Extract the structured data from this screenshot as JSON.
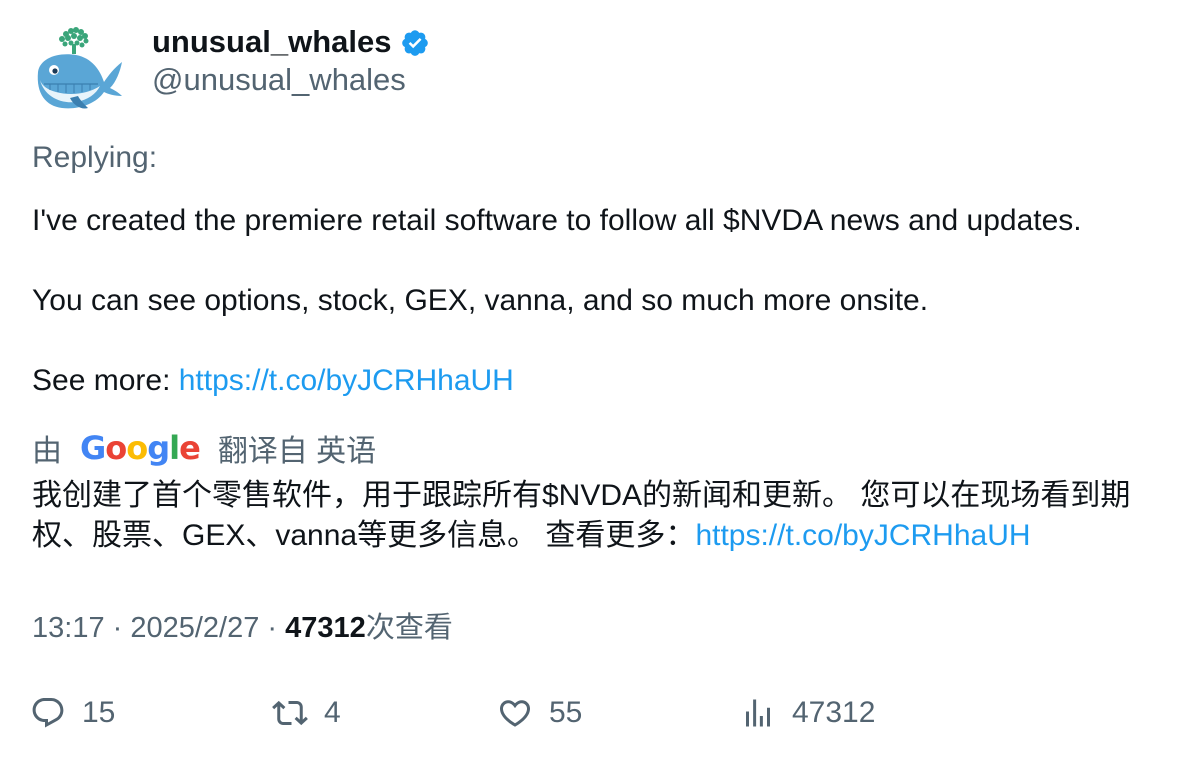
{
  "author": {
    "display_name": "unusual_whales",
    "handle": "@unusual_whales",
    "verified": true,
    "avatar_icon": "whale-logo-icon",
    "verified_icon": "verified-badge-icon"
  },
  "tweet": {
    "replying_label": "Replying:",
    "line1": "I've created the premiere retail software to follow all $NVDA news and updates.",
    "line2": "You can see options, stock, GEX, vanna, and so much more onsite.",
    "line3_prefix": "See more: ",
    "link": "https://t.co/byJCRHhaUH"
  },
  "translation": {
    "by_label": "由",
    "google_letters": [
      "G",
      "o",
      "o",
      "g",
      "l",
      "e"
    ],
    "google_colors": [
      "#4285F4",
      "#EA4335",
      "#FBBC05",
      "#4285F4",
      "#34A853",
      "#EA4335"
    ],
    "from_label": "翻译自 英语",
    "text": "我创建了首个零售软件，用于跟踪所有$NVDA的新闻和更新。 您可以在现场看到期权、股票、GEX、vanna等更多信息。 查看更多：",
    "link": "https://t.co/byJCRHhaUH"
  },
  "meta": {
    "time": "13:17",
    "date": "2025/2/27",
    "sep": " · ",
    "views": "47312",
    "views_label": "次查看"
  },
  "actions": {
    "replies": "15",
    "reposts": "4",
    "likes": "55",
    "views": "47312"
  },
  "colors": {
    "link": "#1d9bf0",
    "verified": "#1d9bf0",
    "secondary_text": "#536471",
    "primary_text": "#0f1419"
  }
}
